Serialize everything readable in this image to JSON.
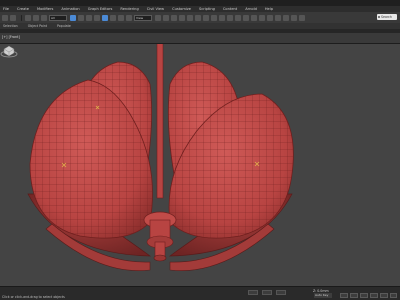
{
  "menubar": {
    "items": [
      "File",
      "Create",
      "Modifiers",
      "Animation",
      "Graph Editors",
      "Rendering",
      "Civil View",
      "Customize",
      "Scripting",
      "Content",
      "Arnold",
      "Help"
    ]
  },
  "toolbar": {
    "selection_filter": "All",
    "view_dropdown": "View",
    "search_placeholder": "Search"
  },
  "ribbon": {
    "items": [
      "Selection",
      "Object Paint",
      "Populate"
    ]
  },
  "viewport": {
    "label": "[+] [Front]",
    "object_color": "#b84442",
    "background": "#444444"
  },
  "statusbar": {
    "status": "Click or click-and-drag to select objects",
    "coordinates": "Z: 0.0mm",
    "autokey_label": "Auto Key"
  }
}
